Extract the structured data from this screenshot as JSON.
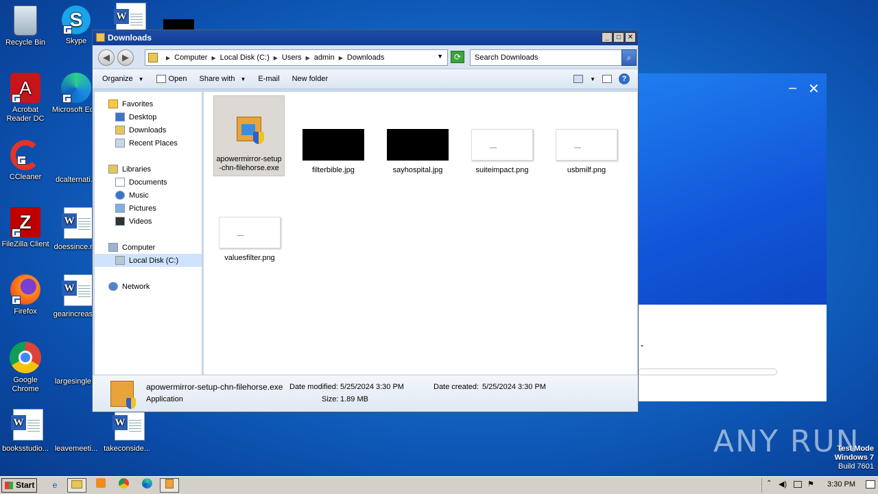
{
  "desktop": {
    "icons": [
      {
        "label": "Recycle Bin"
      },
      {
        "label": "Skype"
      },
      {
        "label": "Acrobat Reader DC"
      },
      {
        "label": "Microsoft Ed..."
      },
      {
        "label": "CCleaner"
      },
      {
        "label": "dcalternati..."
      },
      {
        "label": "FileZilla Client"
      },
      {
        "label": "doessince.r..."
      },
      {
        "label": "Firefox"
      },
      {
        "label": "gearincreas..."
      },
      {
        "label": "Google Chrome"
      },
      {
        "label": "largesingle..."
      },
      {
        "label": "booksstudio..."
      },
      {
        "label": "leavemeeti..."
      },
      {
        "label": "takeconside..."
      }
    ]
  },
  "window": {
    "title": "Downloads",
    "address": [
      "Computer",
      "Local Disk (C:)",
      "Users",
      "admin",
      "Downloads"
    ],
    "search_placeholder": "Search Downloads",
    "toolbar": {
      "organize": "Organize",
      "open": "Open",
      "share_with": "Share with",
      "email": "E-mail",
      "new_folder": "New folder"
    },
    "nav": {
      "favorites": "Favorites",
      "desktop": "Desktop",
      "downloads": "Downloads",
      "recent_places": "Recent Places",
      "libraries": "Libraries",
      "documents": "Documents",
      "music": "Music",
      "pictures": "Pictures",
      "videos": "Videos",
      "computer": "Computer",
      "local_disk": "Local Disk (C:)",
      "network": "Network"
    },
    "files": [
      {
        "name": "apowermirror-setup-chn-filehorse.exe",
        "type": "exe"
      },
      {
        "name": "filterbible.jpg",
        "type": "black"
      },
      {
        "name": "sayhospital.jpg",
        "type": "black"
      },
      {
        "name": "suiteimpact.png",
        "type": "white"
      },
      {
        "name": "usbmilf.png",
        "type": "white"
      },
      {
        "name": "valuesfilter.png",
        "type": "white"
      }
    ],
    "details": {
      "filename": "apowermirror-setup-chn-filehorse.exe",
      "filetype": "Application",
      "date_modified_label": "Date modified:",
      "date_modified": "5/25/2024 3:30 PM",
      "size_label": "Size:",
      "size": "1.89 MB",
      "date_created_label": "Date created:",
      "date_created": "5/25/2024 3:30 PM"
    }
  },
  "taskbar": {
    "start": "Start",
    "clock": "3:30 PM"
  },
  "watermark": {
    "line1": "Test Mode",
    "line2": "Windows 7",
    "line3": "Build 7601",
    "brand": "ANY RUN"
  }
}
